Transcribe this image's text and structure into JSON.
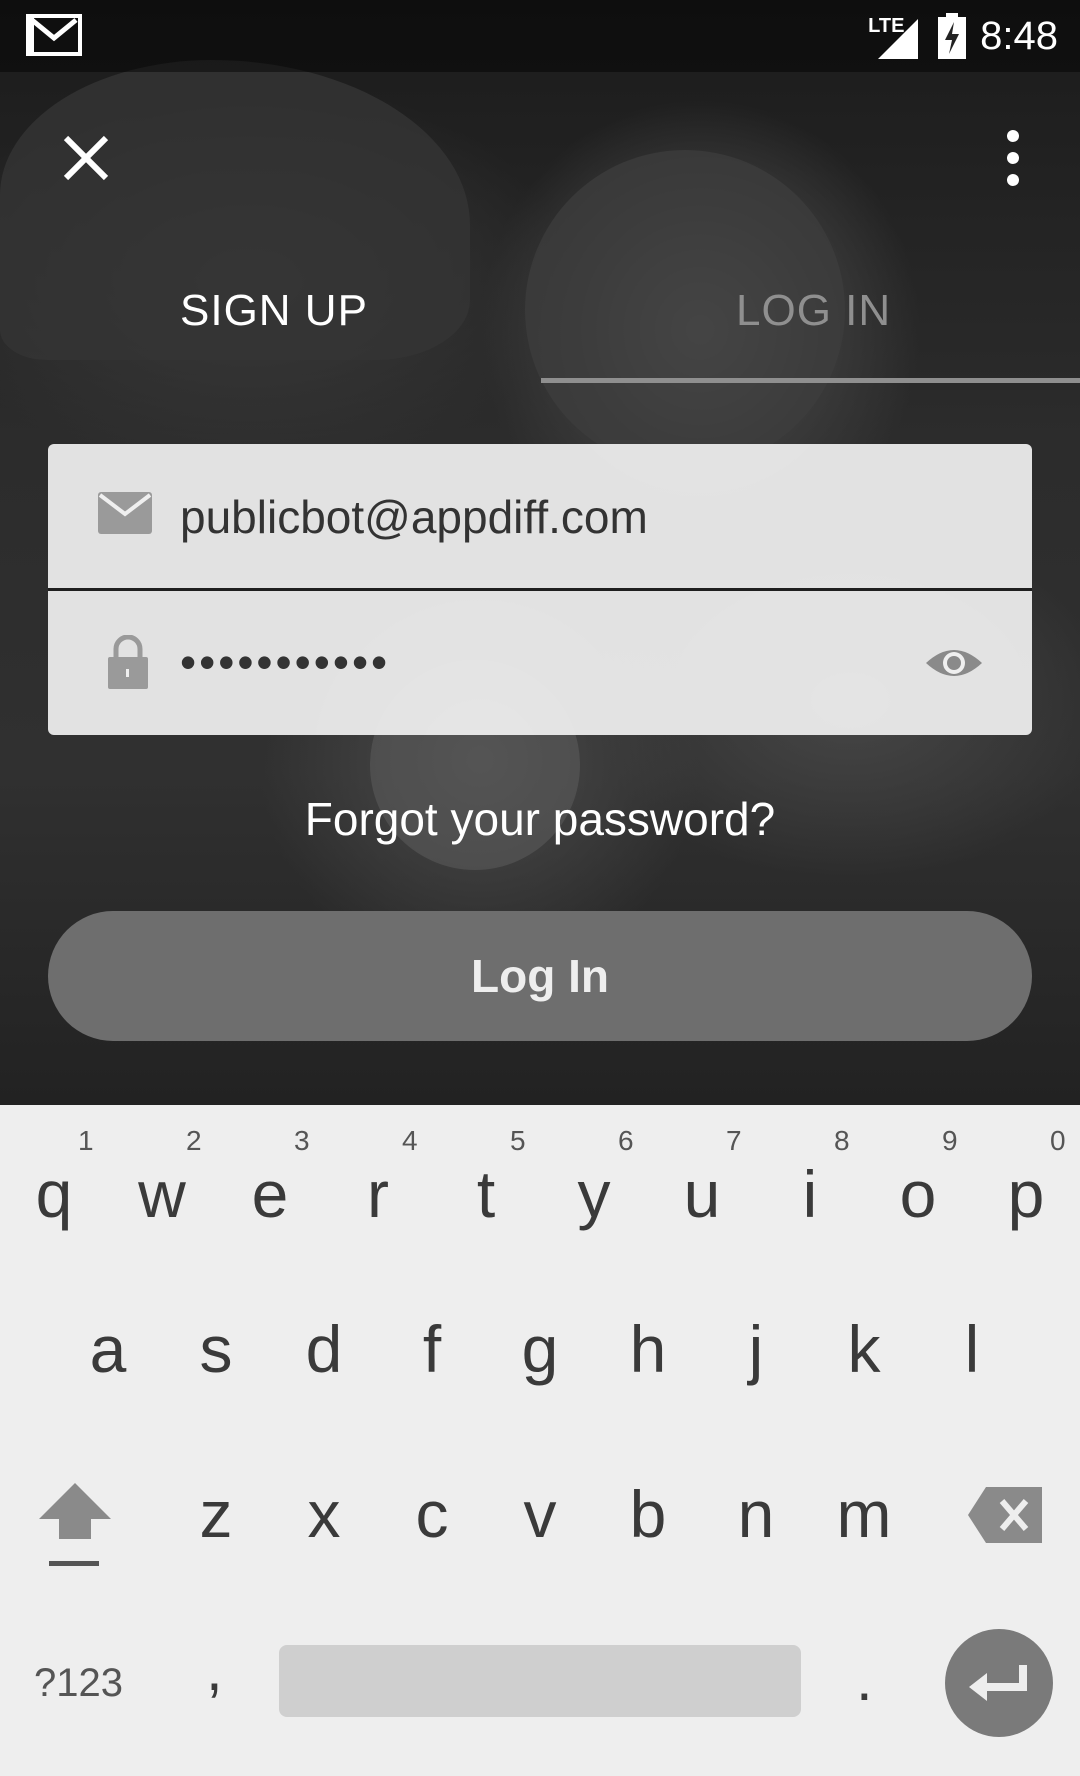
{
  "status_bar": {
    "time": "8:48",
    "network": "LTE",
    "notification_icon": "gmail-icon",
    "battery_icon": "battery-charging-icon"
  },
  "toolbar": {
    "close_icon": "close-icon",
    "overflow_icon": "more-vert-icon"
  },
  "tabs": [
    {
      "label": "SIGN UP",
      "selected": false
    },
    {
      "label": "LOG IN",
      "selected": true
    }
  ],
  "form": {
    "email": {
      "value": "publicbot@appdiff.com",
      "icon": "mail-icon"
    },
    "password": {
      "value": "•••••••••••",
      "icon": "lock-icon",
      "toggle_icon": "eye-icon"
    },
    "forgot_label": "Forgot your password?",
    "submit_label": "Log In"
  },
  "keyboard": {
    "row1": [
      {
        "key": "q",
        "hint": "1"
      },
      {
        "key": "w",
        "hint": "2"
      },
      {
        "key": "e",
        "hint": "3"
      },
      {
        "key": "r",
        "hint": "4"
      },
      {
        "key": "t",
        "hint": "5"
      },
      {
        "key": "y",
        "hint": "6"
      },
      {
        "key": "u",
        "hint": "7"
      },
      {
        "key": "i",
        "hint": "8"
      },
      {
        "key": "o",
        "hint": "9"
      },
      {
        "key": "p",
        "hint": "0"
      }
    ],
    "row2": [
      "a",
      "s",
      "d",
      "f",
      "g",
      "h",
      "j",
      "k",
      "l"
    ],
    "row3": [
      "z",
      "x",
      "c",
      "v",
      "b",
      "n",
      "m"
    ],
    "symbols_label": "?123",
    "comma": ",",
    "period": "."
  },
  "colors": {
    "field_bg": "#f0f0f0",
    "button_bg": "#6e6e6e",
    "keyboard_bg": "#eeeeee",
    "tab_inactive": "#8f8f8f"
  }
}
